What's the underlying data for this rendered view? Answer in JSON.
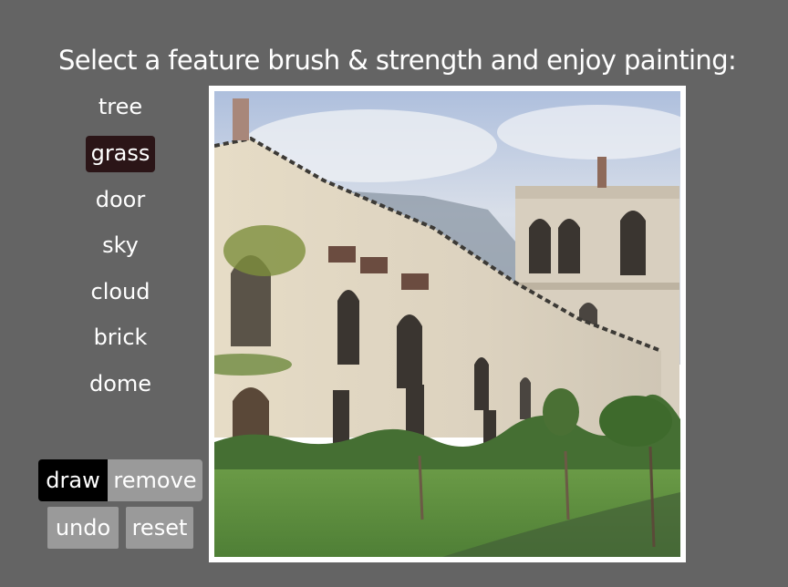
{
  "header": {
    "title": "Select a feature brush & strength and enjoy painting:"
  },
  "brushes": [
    {
      "label": "tree",
      "selected": false
    },
    {
      "label": "grass",
      "selected": true
    },
    {
      "label": "door",
      "selected": false
    },
    {
      "label": "sky",
      "selected": false
    },
    {
      "label": "cloud",
      "selected": false
    },
    {
      "label": "brick",
      "selected": false
    },
    {
      "label": "dome",
      "selected": false
    }
  ],
  "mode": {
    "draw_label": "draw",
    "remove_label": "remove",
    "active": "draw"
  },
  "actions": {
    "undo_label": "undo",
    "reset_label": "reset"
  },
  "canvas": {
    "description": "generated painting of a gothic church building with tower, lawn and shrubs",
    "colors": {
      "sky": "#c9d6ea",
      "wall": "#ded5c2",
      "grass": "#5f9241",
      "shrub": "#3f6a2e",
      "window": "#3a3530",
      "selected_brush": "#2b1517"
    }
  }
}
